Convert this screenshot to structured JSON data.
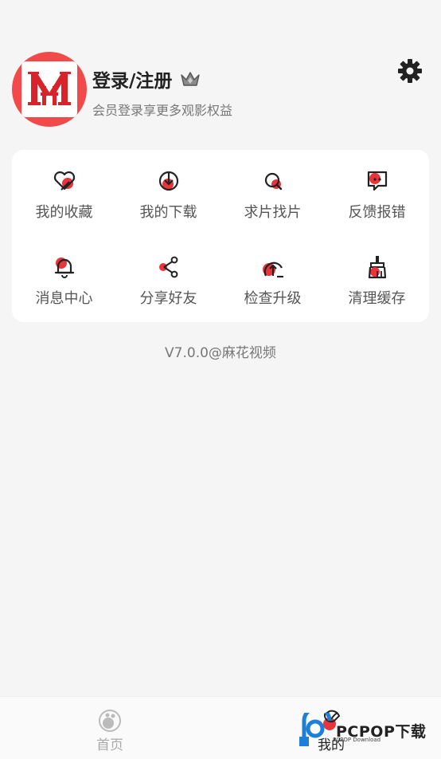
{
  "profile": {
    "title": "登录/注册",
    "subtitle": "会员登录享更多观影权益"
  },
  "menu": {
    "items": [
      {
        "label": "我的收藏",
        "icon": "heart-icon"
      },
      {
        "label": "我的下载",
        "icon": "download-icon"
      },
      {
        "label": "求片找片",
        "icon": "search-icon"
      },
      {
        "label": "反馈报错",
        "icon": "feedback-icon"
      },
      {
        "label": "消息中心",
        "icon": "bell-icon"
      },
      {
        "label": "分享好友",
        "icon": "share-icon"
      },
      {
        "label": "检查升级",
        "icon": "upgrade-icon"
      },
      {
        "label": "清理缓存",
        "icon": "broom-icon"
      }
    ]
  },
  "version": "V7.0.0@麻花视频",
  "tabbar": {
    "home_label": "首页",
    "mine_label": "我的"
  },
  "watermark": {
    "text": "PCPOP下载",
    "sub": "PCPOP Download"
  },
  "colors": {
    "accent": "#e8343a",
    "background": "#f5f5f5",
    "card": "#ffffff"
  }
}
